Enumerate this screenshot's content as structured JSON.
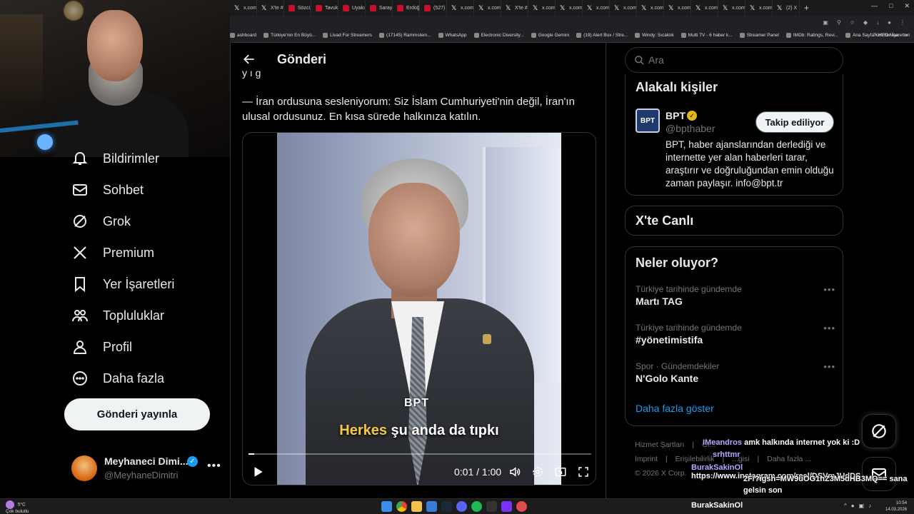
{
  "browser": {
    "tabs": [
      {
        "label": "x.com",
        "icon": "x-icon"
      },
      {
        "label": "X'te #",
        "icon": "x-icon"
      },
      {
        "label": "Sözcü",
        "icon": "red-icon"
      },
      {
        "label": "Tavuk",
        "icon": "red-icon"
      },
      {
        "label": "Uyakı",
        "icon": "red-icon"
      },
      {
        "label": "Saray",
        "icon": "red-icon"
      },
      {
        "label": "Erdoğ",
        "icon": "red-icon"
      },
      {
        "label": "(527)",
        "icon": "youtube-icon"
      },
      {
        "label": "x.com",
        "icon": "x-icon"
      },
      {
        "label": "x.com",
        "icon": "x-icon"
      },
      {
        "label": "X'te #",
        "icon": "x-icon"
      },
      {
        "label": "x.com",
        "icon": "x-icon"
      },
      {
        "label": "x.com",
        "icon": "x-icon"
      },
      {
        "label": "x.com",
        "icon": "x-icon"
      },
      {
        "label": "x.com",
        "icon": "x-icon"
      },
      {
        "label": "x.com",
        "icon": "x-icon"
      },
      {
        "label": "x.com",
        "icon": "x-icon"
      },
      {
        "label": "x.com",
        "icon": "x-icon"
      },
      {
        "label": "x.com",
        "icon": "x-icon"
      },
      {
        "label": "x.com",
        "icon": "x-icon"
      },
      {
        "label": "(2) X",
        "icon": "x-icon"
      }
    ],
    "new_tab": "+",
    "bookmarks": [
      "ashboard",
      "Türkiye'nin En Büyü...",
      "Livad For Streamers",
      "(17145) Rammstein...",
      "WhatsApp",
      "Electronic Diversity...",
      "Google Gemini",
      "(19) Alert Box / Stre...",
      "Windy: Sıcaklık",
      "Multi TV - 6 haber k...",
      "Streamer Panel",
      "IMDb: Ratings, Revi...",
      "Ana Sayfa • HBO Max"
    ],
    "bookmarks_overflow": "»",
    "all_bookmarks": "Tüm Yer İşaretleri"
  },
  "sidebar": {
    "items": [
      {
        "label": "Bildirimler",
        "icon": "bell-icon"
      },
      {
        "label": "Sohbet",
        "icon": "mail-icon"
      },
      {
        "label": "Grok",
        "icon": "grok-icon"
      },
      {
        "label": "Premium",
        "icon": "x-logo-icon"
      },
      {
        "label": "Yer İşaretleri",
        "icon": "bookmark-icon"
      },
      {
        "label": "Topluluklar",
        "icon": "communities-icon"
      },
      {
        "label": "Profil",
        "icon": "person-icon"
      },
      {
        "label": "Daha fazla",
        "icon": "more-circle-icon"
      }
    ],
    "post_button": "Gönderi yayınla",
    "account": {
      "name": "Meyhaneci Dimi...",
      "handle": "@MeyhaneDimitri",
      "verified_mark": "✓",
      "more": "•••"
    }
  },
  "main": {
    "title": "Gönderi",
    "cutoff_text": "y ı g",
    "tweet_text": "— İran ordusuna sesleniyorum: Siz İslam Cumhuriyeti'nin değil, İran'ın ulusal ordusunuz. En kısa sürede halkınıza katılın.",
    "video": {
      "watermark": "BPT",
      "subtitle_highlight": "Herkes",
      "subtitle_rest": " şu anda da tıpkı",
      "time": "0:01 / 1:00",
      "progress": 0.017
    }
  },
  "right": {
    "search_placeholder": "Ara",
    "relevant": {
      "title": "Alakalı kişiler",
      "avatar_text": "BPT",
      "name": "BPT",
      "verified_mark": "✓",
      "handle": "@bpthaber",
      "follow_label": "Takip ediliyor",
      "bio": "BPT, haber ajanslarından derlediği ve internette yer alan haberleri tarar, araştırır ve doğruluğundan emin olduğu zaman paylaşır. info@bpt.tr"
    },
    "live_title": "X'te Canlı",
    "trends": {
      "title": "Neler oluyor?",
      "items": [
        {
          "context": "Türkiye tarihinde gündemde",
          "name": "Martı TAG"
        },
        {
          "context": "Türkiye tarihinde gündemde",
          "name": "#yönetimistifa"
        },
        {
          "context": "Spor · Gündemdekiler",
          "name": "N'Golo Kante"
        }
      ],
      "more_glyph": "•••",
      "show_more": "Daha fazla göster"
    },
    "footer": {
      "line1": [
        "Hizmet Şartları",
        "|",
        "Gi..."
      ],
      "line2": [
        "Imprint",
        "|",
        "Erişilebilirlik",
        "|",
        "...gisi",
        "|",
        "Daha fazla ..."
      ],
      "line3": "© 2026 X Corp."
    }
  },
  "chat": [
    {
      "user": "IMeandros",
      "message": "amk halkında internet yok ki :D"
    },
    {
      "user": "srhttmr",
      "message": ""
    },
    {
      "user": "BurakSakinOl",
      "message": "https://www.instagram.com/reel/DSVmJUdDS"
    },
    {
      "user": "",
      "message": "2F/?igsh=MW9uOG1hZ3M5dHB3MQ== sana"
    },
    {
      "user": "",
      "message": "gelsin son"
    }
  ],
  "taskbar": {
    "weather_temp": "5°C",
    "weather_desc": "Çok bulutlu",
    "streamer": "BurakSakinOl",
    "time": "10:54",
    "date": "14.03.2026"
  },
  "colors": {
    "accent": "#1d9bf0",
    "background": "#000000",
    "border": "#2f3336",
    "muted_text": "#71767b",
    "subtitle_highlight": "#f5c842"
  }
}
